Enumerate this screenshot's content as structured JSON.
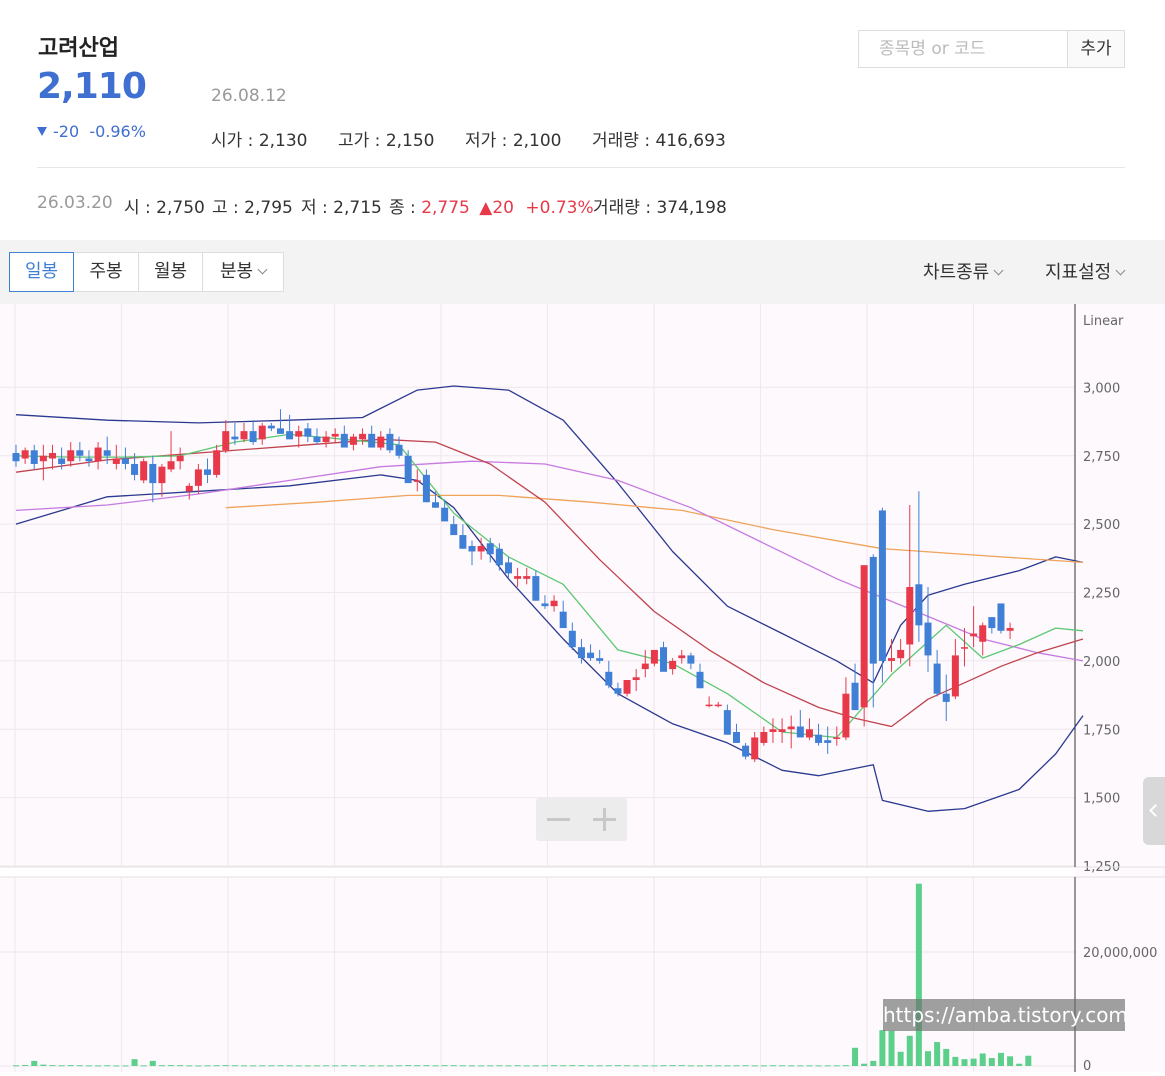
{
  "header": {
    "stock_name": "고려산업",
    "price": "2,110",
    "date": "26.08.12",
    "change": "-20",
    "change_pct": "-0.96%",
    "open": "시가 : 2,130",
    "high": "고가 : 2,150",
    "low": "저가 : 2,100",
    "volume": "거래량 : 416,693"
  },
  "search": {
    "placeholder": "종목명 or 코드",
    "value": "",
    "add_label": "추가"
  },
  "prev_day": {
    "date": "26.03.20",
    "open": "시 : 2,750",
    "high": "고 : 2,795",
    "low": "저 : 2,715",
    "close_label": "종 :",
    "close": "2,775",
    "change": "20",
    "change_pct": "+0.73%",
    "volume": "거래량 : 374,198"
  },
  "toolbar": {
    "periods": [
      "일봉",
      "주봉",
      "월봉",
      "분봉"
    ],
    "active_period": "일봉",
    "chart_type_label": "차트종류",
    "indicator_label": "지표설정"
  },
  "colors": {
    "up": "#e8394b",
    "down": "#3f7fd6",
    "volume": "#5ccf8a",
    "accent": "#3f7fd6"
  },
  "icons": {
    "change_down": "triangle-down-icon",
    "prev_up": "triangle-up-icon",
    "side_panel": "chevron-left-icon",
    "zoom_out": "minus-icon",
    "zoom_in": "plus-icon"
  },
  "watermark": "https://amba.tistory.com",
  "chart_data": {
    "type": "candlestick",
    "scale_label": "Linear",
    "y_ticks": [
      "3,000",
      "2,750",
      "2,500",
      "2,250",
      "2,000",
      "1,750",
      "1,500",
      "1,250"
    ],
    "ylim": [
      1250,
      3250
    ],
    "volume_ticks": [
      "20,000,000",
      "0"
    ],
    "volume_ylim": [
      0,
      33000000
    ],
    "candles": [
      [
        2760,
        2790,
        2710,
        2730
      ],
      [
        2740,
        2780,
        2720,
        2770
      ],
      [
        2770,
        2790,
        2700,
        2720
      ],
      [
        2730,
        2790,
        2660,
        2750
      ],
      [
        2740,
        2790,
        2700,
        2760
      ],
      [
        2740,
        2780,
        2700,
        2720
      ],
      [
        2730,
        2800,
        2710,
        2770
      ],
      [
        2770,
        2800,
        2730,
        2750
      ],
      [
        2740,
        2770,
        2710,
        2730
      ],
      [
        2730,
        2800,
        2700,
        2780
      ],
      [
        2770,
        2820,
        2720,
        2750
      ],
      [
        2720,
        2790,
        2700,
        2740
      ],
      [
        2740,
        2780,
        2700,
        2720
      ],
      [
        2720,
        2760,
        2660,
        2680
      ],
      [
        2660,
        2740,
        2650,
        2730
      ],
      [
        2720,
        2750,
        2580,
        2650
      ],
      [
        2650,
        2720,
        2600,
        2710
      ],
      [
        2700,
        2840,
        2690,
        2730
      ],
      [
        2730,
        2780,
        2700,
        2750
      ],
      [
        2620,
        2650,
        2590,
        2640
      ],
      [
        2640,
        2720,
        2610,
        2700
      ],
      [
        2700,
        2740,
        2650,
        2680
      ],
      [
        2680,
        2790,
        2670,
        2770
      ],
      [
        2770,
        2880,
        2760,
        2840
      ],
      [
        2820,
        2870,
        2790,
        2810
      ],
      [
        2810,
        2870,
        2800,
        2840
      ],
      [
        2840,
        2880,
        2790,
        2800
      ],
      [
        2810,
        2870,
        2790,
        2860
      ],
      [
        2860,
        2870,
        2840,
        2850
      ],
      [
        2850,
        2920,
        2840,
        2830
      ],
      [
        2840,
        2900,
        2820,
        2810
      ],
      [
        2820,
        2860,
        2780,
        2840
      ],
      [
        2850,
        2870,
        2800,
        2820
      ],
      [
        2820,
        2850,
        2790,
        2800
      ],
      [
        2800,
        2840,
        2780,
        2820
      ],
      [
        2820,
        2850,
        2800,
        2830
      ],
      [
        2830,
        2860,
        2800,
        2780
      ],
      [
        2790,
        2830,
        2770,
        2820
      ],
      [
        2810,
        2850,
        2790,
        2830
      ],
      [
        2830,
        2860,
        2780,
        2780
      ],
      [
        2780,
        2840,
        2770,
        2820
      ],
      [
        2830,
        2850,
        2760,
        2770
      ],
      [
        2790,
        2820,
        2740,
        2750
      ],
      [
        2750,
        2770,
        2700,
        2650
      ],
      [
        2660,
        2700,
        2620,
        2660
      ],
      [
        2680,
        2700,
        2580,
        2580
      ],
      [
        2580,
        2620,
        2560,
        2560
      ],
      [
        2560,
        2590,
        2520,
        2510
      ],
      [
        2500,
        2530,
        2470,
        2460
      ],
      [
        2460,
        2500,
        2410,
        2410
      ],
      [
        2420,
        2440,
        2350,
        2400
      ],
      [
        2400,
        2450,
        2370,
        2420
      ],
      [
        2430,
        2450,
        2360,
        2390
      ],
      [
        2410,
        2430,
        2330,
        2350
      ],
      [
        2360,
        2380,
        2300,
        2320
      ],
      [
        2300,
        2340,
        2270,
        2310
      ],
      [
        2300,
        2340,
        2280,
        2310
      ],
      [
        2310,
        2330,
        2220,
        2220
      ],
      [
        2210,
        2240,
        2190,
        2200
      ],
      [
        2200,
        2240,
        2180,
        2220
      ],
      [
        2180,
        2220,
        2150,
        2120
      ],
      [
        2110,
        2140,
        2040,
        2050
      ],
      [
        2050,
        2080,
        1990,
        2010
      ],
      [
        2030,
        2060,
        2000,
        2010
      ],
      [
        2010,
        2040,
        1990,
        2000
      ],
      [
        1960,
        2000,
        1900,
        1910
      ],
      [
        1900,
        1920,
        1870,
        1880
      ],
      [
        1880,
        1930,
        1870,
        1930
      ],
      [
        1930,
        1970,
        1890,
        1940
      ],
      [
        1970,
        2040,
        1940,
        1990
      ],
      [
        1990,
        2040,
        1980,
        2040
      ],
      [
        2050,
        2070,
        1990,
        1960
      ],
      [
        1970,
        2010,
        1950,
        2000
      ],
      [
        2010,
        2040,
        1990,
        2020
      ],
      [
        2020,
        2030,
        1970,
        1990
      ],
      [
        1960,
        1990,
        1900,
        1900
      ],
      [
        1840,
        1870,
        1830,
        1840
      ],
      [
        1840,
        1850,
        1830,
        1840
      ],
      [
        1820,
        1840,
        1730,
        1730
      ],
      [
        1740,
        1770,
        1700,
        1700
      ],
      [
        1690,
        1700,
        1640,
        1650
      ],
      [
        1640,
        1740,
        1630,
        1720
      ],
      [
        1700,
        1760,
        1690,
        1740
      ],
      [
        1740,
        1790,
        1700,
        1750
      ],
      [
        1740,
        1790,
        1700,
        1750
      ],
      [
        1750,
        1800,
        1680,
        1760
      ],
      [
        1760,
        1820,
        1730,
        1720
      ],
      [
        1720,
        1790,
        1710,
        1750
      ],
      [
        1730,
        1770,
        1690,
        1700
      ],
      [
        1710,
        1760,
        1660,
        1700
      ],
      [
        1720,
        1760,
        1690,
        1720
      ],
      [
        1720,
        1940,
        1710,
        1880
      ],
      [
        1920,
        1990,
        1850,
        1820
      ],
      [
        1830,
        2050,
        1760,
        2350
      ],
      [
        2380,
        2390,
        1830,
        1990
      ],
      [
        2550,
        2560,
        1920,
        2000
      ],
      [
        2000,
        2080,
        1960,
        2010
      ],
      [
        2010,
        2080,
        1990,
        2040
      ],
      [
        2060,
        2570,
        1980,
        2270
      ],
      [
        2280,
        2620,
        2070,
        2130
      ],
      [
        2140,
        2270,
        1960,
        2020
      ],
      [
        1990,
        2040,
        1870,
        1880
      ],
      [
        1880,
        1950,
        1780,
        1850
      ],
      [
        1870,
        2080,
        1860,
        2020
      ],
      [
        2050,
        2120,
        1980,
        2050
      ],
      [
        2090,
        2200,
        2050,
        2100
      ],
      [
        2070,
        2140,
        2020,
        2130
      ],
      [
        2160,
        2160,
        2100,
        2120
      ],
      [
        2210,
        2210,
        2100,
        2110
      ],
      [
        2110,
        2140,
        2080,
        2120
      ]
    ],
    "volumes": [
      120000,
      180000,
      900000,
      240000,
      160000,
      130000,
      150000,
      140000,
      120000,
      110000,
      130000,
      100000,
      100000,
      1200000,
      110000,
      900000,
      140000,
      160000,
      150000,
      110000,
      100000,
      120000,
      140000,
      160000,
      130000,
      120000,
      110000,
      120000,
      130000,
      140000,
      120000,
      110000,
      110000,
      120000,
      130000,
      120000,
      140000,
      130000,
      130000,
      110000,
      120000,
      110000,
      130000,
      160000,
      140000,
      150000,
      120000,
      150000,
      140000,
      130000,
      120000,
      110000,
      120000,
      130000,
      120000,
      140000,
      110000,
      120000,
      130000,
      140000,
      130000,
      150000,
      140000,
      120000,
      130000,
      140000,
      150000,
      130000,
      120000,
      120000,
      110000,
      140000,
      150000,
      160000,
      120000,
      110000,
      130000,
      120000,
      120000,
      130000,
      140000,
      120000,
      120000,
      130000,
      130000,
      120000,
      110000,
      120000,
      110000,
      120000,
      120000,
      140000,
      3200000,
      400000,
      900000,
      6300000,
      6200000,
      2500000,
      5300000,
      32000000,
      2600000,
      4200000,
      3000000,
      1600000,
      1200000,
      1300000,
      2200000,
      1400000,
      2300000,
      1700000,
      400000,
      1800000
    ],
    "indicators": {
      "ma5": [
        [
          0,
          2750
        ],
        [
          6,
          2745
        ],
        [
          12,
          2745
        ],
        [
          18,
          2750
        ],
        [
          24,
          2800
        ],
        [
          30,
          2828
        ],
        [
          36,
          2810
        ],
        [
          42,
          2790
        ],
        [
          48,
          2540
        ],
        [
          54,
          2380
        ],
        [
          60,
          2280
        ],
        [
          66,
          2040
        ],
        [
          72,
          1990
        ],
        [
          78,
          1880
        ],
        [
          84,
          1740
        ],
        [
          90,
          1720
        ],
        [
          96,
          1950
        ],
        [
          102,
          2130
        ],
        [
          106,
          2010
        ],
        [
          110,
          2060
        ],
        [
          114,
          2120
        ],
        [
          117,
          2110
        ]
      ],
      "ma20": [
        [
          0,
          2690
        ],
        [
          10,
          2735
        ],
        [
          20,
          2760
        ],
        [
          30,
          2785
        ],
        [
          40,
          2810
        ],
        [
          46,
          2800
        ],
        [
          52,
          2720
        ],
        [
          58,
          2580
        ],
        [
          64,
          2370
        ],
        [
          70,
          2180
        ],
        [
          76,
          2040
        ],
        [
          82,
          1920
        ],
        [
          88,
          1830
        ],
        [
          92,
          1790
        ],
        [
          96,
          1760
        ],
        [
          100,
          1860
        ],
        [
          104,
          1920
        ],
        [
          108,
          1980
        ],
        [
          112,
          2030
        ],
        [
          117,
          2080
        ]
      ],
      "ma60": [
        [
          0,
          2550
        ],
        [
          10,
          2570
        ],
        [
          20,
          2610
        ],
        [
          30,
          2660
        ],
        [
          40,
          2710
        ],
        [
          50,
          2730
        ],
        [
          58,
          2720
        ],
        [
          66,
          2660
        ],
        [
          74,
          2560
        ],
        [
          82,
          2430
        ],
        [
          90,
          2300
        ],
        [
          98,
          2190
        ],
        [
          106,
          2080
        ],
        [
          112,
          2030
        ],
        [
          117,
          2000
        ]
      ],
      "ma120": [
        [
          23,
          2560
        ],
        [
          33,
          2580
        ],
        [
          43,
          2605
        ],
        [
          53,
          2605
        ],
        [
          63,
          2580
        ],
        [
          73,
          2550
        ],
        [
          83,
          2480
        ],
        [
          95,
          2410
        ],
        [
          106,
          2385
        ],
        [
          117,
          2360
        ]
      ],
      "bb_upper": [
        [
          0,
          2900
        ],
        [
          10,
          2880
        ],
        [
          20,
          2870
        ],
        [
          30,
          2880
        ],
        [
          38,
          2890
        ],
        [
          44,
          2990
        ],
        [
          48,
          3005
        ],
        [
          54,
          2990
        ],
        [
          60,
          2880
        ],
        [
          66,
          2650
        ],
        [
          72,
          2400
        ],
        [
          78,
          2200
        ],
        [
          84,
          2100
        ],
        [
          90,
          2000
        ],
        [
          94,
          1920
        ],
        [
          97,
          2130
        ],
        [
          100,
          2240
        ],
        [
          104,
          2280
        ],
        [
          110,
          2330
        ],
        [
          114,
          2380
        ],
        [
          117,
          2360
        ]
      ],
      "bb_lower": [
        [
          0,
          2500
        ],
        [
          10,
          2600
        ],
        [
          20,
          2620
        ],
        [
          30,
          2640
        ],
        [
          40,
          2680
        ],
        [
          44,
          2660
        ],
        [
          48,
          2560
        ],
        [
          54,
          2300
        ],
        [
          60,
          2080
        ],
        [
          66,
          1880
        ],
        [
          72,
          1770
        ],
        [
          78,
          1700
        ],
        [
          84,
          1600
        ],
        [
          88,
          1580
        ],
        [
          94,
          1620
        ],
        [
          95,
          1490
        ],
        [
          100,
          1450
        ],
        [
          104,
          1460
        ],
        [
          110,
          1530
        ],
        [
          114,
          1660
        ],
        [
          117,
          1800
        ]
      ]
    }
  }
}
